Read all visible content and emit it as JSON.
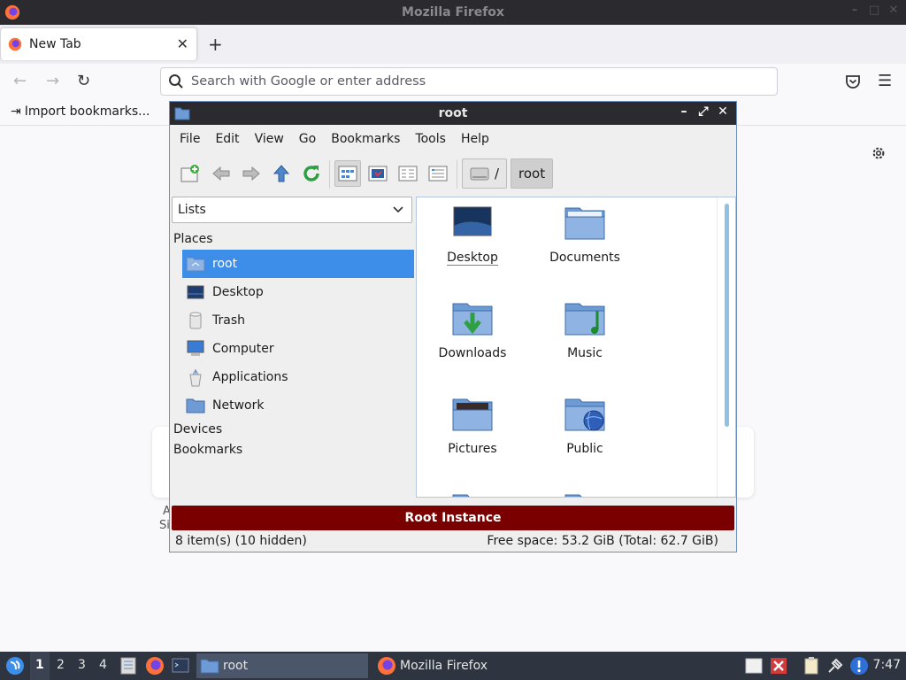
{
  "firefox": {
    "window_title": "Mozilla Firefox",
    "tab_label": "New Tab",
    "urlbar_placeholder": "Search with Google or enter address",
    "bookmarks_import": "Import bookmarks...",
    "ghost_text_1": "A",
    "ghost_text_2": "Si"
  },
  "filemanager": {
    "title": "root",
    "menu": [
      "File",
      "Edit",
      "View",
      "Go",
      "Bookmarks",
      "Tools",
      "Help"
    ],
    "path_root": "/",
    "path_current": "root",
    "side_mode": "Lists",
    "places_header": "Places",
    "places": [
      "root",
      "Desktop",
      "Trash",
      "Computer",
      "Applications",
      "Network"
    ],
    "devices_header": "Devices",
    "bookmarks_header": "Bookmarks",
    "files": [
      "Desktop",
      "Documents",
      "Downloads",
      "Music",
      "Pictures",
      "Public"
    ],
    "banner": "Root Instance",
    "status_items": "8 item(s) (10 hidden)",
    "status_space": "Free space: 53.2 GiB (Total: 62.7 GiB)"
  },
  "taskbar": {
    "desktops": [
      "1",
      "2",
      "3",
      "4"
    ],
    "tasks": [
      "root",
      "Mozilla Firefox"
    ],
    "clock": "7:47"
  },
  "colors": {
    "banner": "#7a0000",
    "selection": "#3d8ee8",
    "taskbar": "#2e3440",
    "titlebar": "#2b2b2f"
  }
}
